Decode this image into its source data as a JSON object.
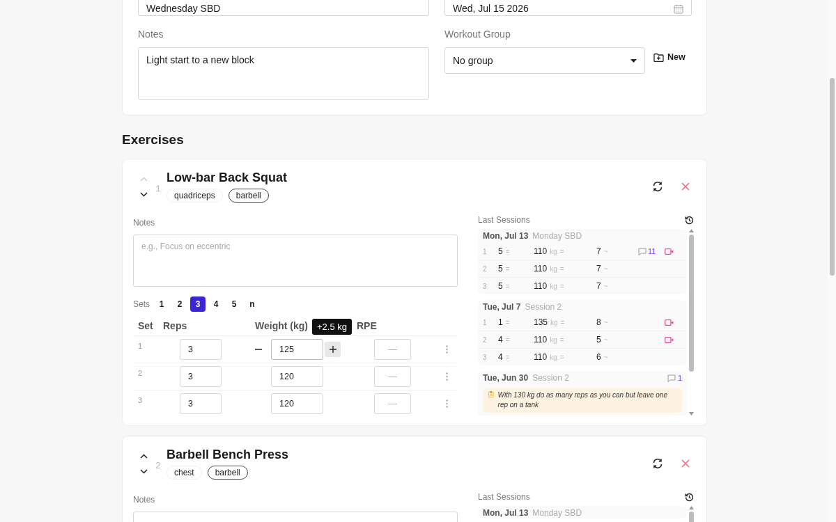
{
  "workout_form": {
    "name_value": "Wednesday SBD",
    "date_value": "Wed, Jul 15 2026",
    "notes_label": "Notes",
    "notes_value": "Light start to a new block",
    "group_label": "Workout Group",
    "group_value": "No group",
    "new_button": "New"
  },
  "exercises_heading": "Exercises",
  "exercises": [
    {
      "number": "1",
      "name": "Low-bar Back Squat",
      "move_up_disabled": true,
      "tags": [
        {
          "label": "quadriceps",
          "outlined": false
        },
        {
          "label": "barbell",
          "outlined": true
        }
      ],
      "notes_label": "Notes",
      "notes_placeholder": "e.g., Focus on eccentric",
      "sets_label": "Sets",
      "set_options": [
        {
          "label": "1",
          "selected": false
        },
        {
          "label": "2",
          "selected": false
        },
        {
          "label": "3",
          "selected": true
        },
        {
          "label": "4",
          "selected": false
        },
        {
          "label": "5",
          "selected": false
        },
        {
          "label": "n",
          "selected": false
        }
      ],
      "columns": [
        "Set",
        "Reps",
        "Weight (kg)",
        "RPE"
      ],
      "rows": [
        {
          "set": "1",
          "reps": "3",
          "weight": "125",
          "rpe_placeholder": "—",
          "focused": true,
          "tooltip": "+2.5 kg"
        },
        {
          "set": "2",
          "reps": "3",
          "weight": "120",
          "rpe_placeholder": "—",
          "focused": false
        },
        {
          "set": "3",
          "reps": "3",
          "weight": "120",
          "rpe_placeholder": "—",
          "focused": false
        }
      ],
      "last_sessions_label": "Last Sessions",
      "sessions": [
        {
          "date": "Mon, Jul 13",
          "name": "Monday SBD",
          "sets": [
            {
              "set": "1",
              "reps": "5",
              "reps_mark": "=",
              "weight": "110",
              "unit": "kg",
              "weight_mark": "=",
              "rpe": "7",
              "rpe_mark": "~",
              "comments": "11",
              "video": true
            },
            {
              "set": "2",
              "reps": "5",
              "reps_mark": "=",
              "weight": "110",
              "unit": "kg",
              "weight_mark": "=",
              "rpe": "7",
              "rpe_mark": "~",
              "video": false
            },
            {
              "set": "3",
              "reps": "5",
              "reps_mark": "=",
              "weight": "110",
              "unit": "kg",
              "weight_mark": "=",
              "rpe": "7",
              "rpe_mark": "~",
              "video": false
            }
          ]
        },
        {
          "date": "Tue, Jul 7",
          "name": "Session 2",
          "sets": [
            {
              "set": "1",
              "reps": "1",
              "reps_mark": "=",
              "weight": "135",
              "unit": "kg",
              "weight_mark": "=",
              "rpe": "8",
              "rpe_mark": "~",
              "video": true
            },
            {
              "set": "2",
              "reps": "4",
              "reps_mark": "=",
              "weight": "110",
              "unit": "kg",
              "weight_mark": "=",
              "rpe": "5",
              "rpe_mark": "~",
              "video": true
            },
            {
              "set": "3",
              "reps": "4",
              "reps_mark": "=",
              "weight": "110",
              "unit": "kg",
              "weight_mark": "=",
              "rpe": "6",
              "rpe_mark": "~",
              "video": false
            }
          ]
        },
        {
          "date": "Tue, Jun 30",
          "name": "Session 2",
          "comments": "1",
          "note": "With 130 kg do as many reps as you can but leave one rep on a tank"
        }
      ]
    },
    {
      "number": "2",
      "name": "Barbell Bench Press",
      "move_up_disabled": false,
      "tags": [
        {
          "label": "chest",
          "outlined": false
        },
        {
          "label": "barbell",
          "outlined": true
        }
      ],
      "notes_label": "Notes",
      "last_sessions_label": "Last Sessions",
      "sessions": [
        {
          "date": "Mon, Jul 13",
          "name": "Monday SBD"
        }
      ]
    }
  ]
}
